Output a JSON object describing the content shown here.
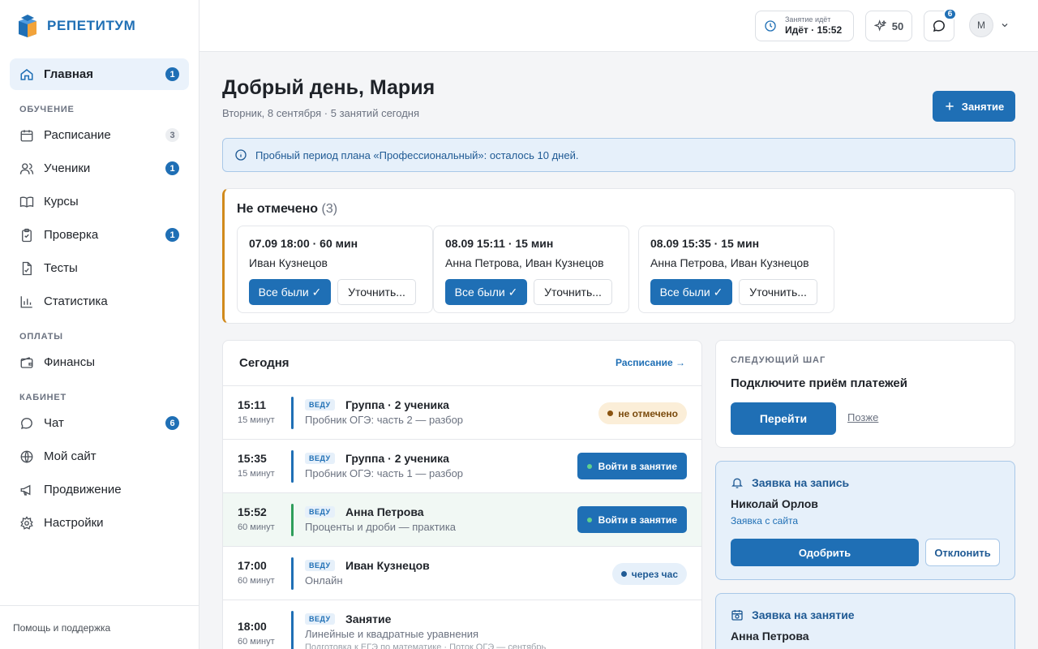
{
  "brand": {
    "name": "РЕПЕТИТУМ",
    "accent": "#1f6fb5"
  },
  "sidebar": {
    "items": [
      {
        "label": "Главная",
        "badge": "1",
        "icon": "home-icon",
        "active": true
      }
    ],
    "sections": [
      {
        "title": "ОБУЧЕНИЕ",
        "items": [
          {
            "label": "Расписание",
            "badge": "3",
            "badge_style": "grey",
            "icon": "calendar-icon"
          },
          {
            "label": "Ученики",
            "badge": "1",
            "icon": "users-icon"
          },
          {
            "label": "Курсы",
            "badge": "",
            "icon": "book-icon"
          },
          {
            "label": "Проверка",
            "badge": "1",
            "icon": "clipboard-icon"
          },
          {
            "label": "Тесты",
            "badge": "",
            "icon": "test-file-icon"
          },
          {
            "label": "Статистика",
            "badge": "",
            "icon": "bar-chart-icon"
          }
        ]
      },
      {
        "title": "ОПЛАТЫ",
        "items": [
          {
            "label": "Финансы",
            "badge": "",
            "icon": "wallet-icon"
          }
        ]
      },
      {
        "title": "КАБИНЕТ",
        "items": [
          {
            "label": "Чат",
            "badge": "6",
            "icon": "chat-icon"
          },
          {
            "label": "Мой сайт",
            "badge": "",
            "icon": "globe-icon"
          },
          {
            "label": "Продвижение",
            "badge": "",
            "icon": "megaphone-icon"
          },
          {
            "label": "Настройки",
            "badge": "",
            "icon": "gear-icon"
          }
        ]
      }
    ],
    "footer": "Помощь и поддержка"
  },
  "topbar": {
    "lesson_status": {
      "label": "Занятие идёт",
      "value": "Идёт · 15:52"
    },
    "points": "50",
    "chat_badge": "6",
    "avatar_initial": "М"
  },
  "main": {
    "greeting": "Добрый день, Мария",
    "subline": "Вторник, 8 сентября · 5 занятий сегодня",
    "add_button": "Занятие",
    "trial_notice": "Пробный период плана «Профессиональный»: осталось 10 дней."
  },
  "unmarked": {
    "title": "Не отмечено",
    "count": "(3)",
    "cards": [
      {
        "when": "07.09 18:00 · 60 мин",
        "who": "Иван Кузнецов",
        "all_present": "Все были ✓",
        "clarify": "Уточнить..."
      },
      {
        "when": "08.09 15:11 · 15 мин",
        "who": "Анна Петрова, Иван Кузнецов",
        "all_present": "Все были ✓",
        "clarify": "Уточнить..."
      },
      {
        "when": "08.09 15:35 · 15 мин",
        "who": "Анна Петрова, Иван Кузнецов",
        "all_present": "Все были ✓",
        "clarify": "Уточнить..."
      }
    ]
  },
  "today": {
    "title": "Сегодня",
    "link": "Расписание →",
    "rows": [
      {
        "time": "15:11",
        "duration": "15 минут",
        "tag": "ВЕДУ",
        "title": "Группа · 2 ученика",
        "desc": "Пробник ОГЭ: часть 2 — разбор",
        "desc2": "",
        "status": "не отмечено",
        "status_type": "warn"
      },
      {
        "time": "15:35",
        "duration": "15 минут",
        "tag": "ВЕДУ",
        "title": "Группа · 2 ученика",
        "desc": "Пробник ОГЭ: часть 1 — разбор",
        "desc2": "",
        "status": "Войти в занятие",
        "status_type": "join"
      },
      {
        "time": "15:52",
        "duration": "60 минут",
        "tag": "ВЕДУ",
        "title": "Анна Петрова",
        "desc": "Проценты и дроби — практика",
        "desc2": "",
        "status": "Войти в занятие",
        "status_type": "join",
        "highlight": true
      },
      {
        "time": "17:00",
        "duration": "60 минут",
        "tag": "ВЕДУ",
        "title": "Иван Кузнецов",
        "desc": "Онлайн",
        "desc2": "",
        "status": "через час",
        "status_type": "info"
      },
      {
        "time": "18:00",
        "duration": "60 минут",
        "tag": "ВЕДУ",
        "title": "Занятие",
        "desc": "Линейные и квадратные уравнения",
        "desc2": "Подготовка к ЕГЭ по математике · Поток ОГЭ — сентябрь",
        "status": "",
        "status_type": "none"
      }
    ]
  },
  "next_step": {
    "label": "СЛЕДУЮЩИЙ ШАГ",
    "title": "Подключите приём платежей",
    "go": "Перейти",
    "later": "Позже"
  },
  "booking_request": {
    "title": "Заявка на запись",
    "name": "Николай Орлов",
    "source": "Заявка с сайта",
    "approve": "Одобрить",
    "decline": "Отклонить"
  },
  "lesson_request": {
    "title": "Заявка на занятие",
    "name": "Анна Петрова"
  }
}
